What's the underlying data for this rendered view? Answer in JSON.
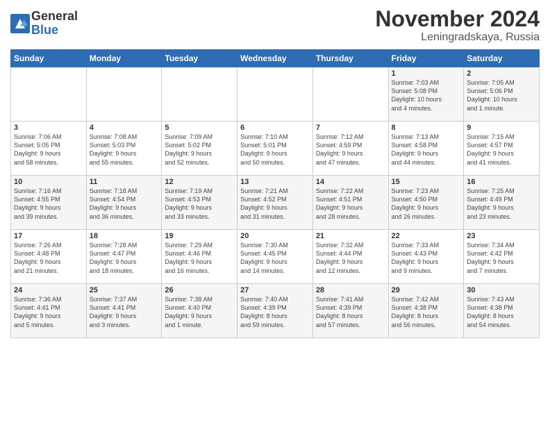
{
  "header": {
    "logo_general": "General",
    "logo_blue": "Blue",
    "month_title": "November 2024",
    "location": "Leningradskaya, Russia"
  },
  "weekdays": [
    "Sunday",
    "Monday",
    "Tuesday",
    "Wednesday",
    "Thursday",
    "Friday",
    "Saturday"
  ],
  "weeks": [
    [
      {
        "day": "",
        "info": ""
      },
      {
        "day": "",
        "info": ""
      },
      {
        "day": "",
        "info": ""
      },
      {
        "day": "",
        "info": ""
      },
      {
        "day": "",
        "info": ""
      },
      {
        "day": "1",
        "info": "Sunrise: 7:03 AM\nSunset: 5:08 PM\nDaylight: 10 hours\nand 4 minutes."
      },
      {
        "day": "2",
        "info": "Sunrise: 7:05 AM\nSunset: 5:06 PM\nDaylight: 10 hours\nand 1 minute."
      }
    ],
    [
      {
        "day": "3",
        "info": "Sunrise: 7:06 AM\nSunset: 5:05 PM\nDaylight: 9 hours\nand 58 minutes."
      },
      {
        "day": "4",
        "info": "Sunrise: 7:08 AM\nSunset: 5:03 PM\nDaylight: 9 hours\nand 55 minutes."
      },
      {
        "day": "5",
        "info": "Sunrise: 7:09 AM\nSunset: 5:02 PM\nDaylight: 9 hours\nand 52 minutes."
      },
      {
        "day": "6",
        "info": "Sunrise: 7:10 AM\nSunset: 5:01 PM\nDaylight: 9 hours\nand 50 minutes."
      },
      {
        "day": "7",
        "info": "Sunrise: 7:12 AM\nSunset: 4:59 PM\nDaylight: 9 hours\nand 47 minutes."
      },
      {
        "day": "8",
        "info": "Sunrise: 7:13 AM\nSunset: 4:58 PM\nDaylight: 9 hours\nand 44 minutes."
      },
      {
        "day": "9",
        "info": "Sunrise: 7:15 AM\nSunset: 4:57 PM\nDaylight: 9 hours\nand 41 minutes."
      }
    ],
    [
      {
        "day": "10",
        "info": "Sunrise: 7:16 AM\nSunset: 4:55 PM\nDaylight: 9 hours\nand 39 minutes."
      },
      {
        "day": "11",
        "info": "Sunrise: 7:18 AM\nSunset: 4:54 PM\nDaylight: 9 hours\nand 36 minutes."
      },
      {
        "day": "12",
        "info": "Sunrise: 7:19 AM\nSunset: 4:53 PM\nDaylight: 9 hours\nand 33 minutes."
      },
      {
        "day": "13",
        "info": "Sunrise: 7:21 AM\nSunset: 4:52 PM\nDaylight: 9 hours\nand 31 minutes."
      },
      {
        "day": "14",
        "info": "Sunrise: 7:22 AM\nSunset: 4:51 PM\nDaylight: 9 hours\nand 28 minutes."
      },
      {
        "day": "15",
        "info": "Sunrise: 7:23 AM\nSunset: 4:50 PM\nDaylight: 9 hours\nand 26 minutes."
      },
      {
        "day": "16",
        "info": "Sunrise: 7:25 AM\nSunset: 4:49 PM\nDaylight: 9 hours\nand 23 minutes."
      }
    ],
    [
      {
        "day": "17",
        "info": "Sunrise: 7:26 AM\nSunset: 4:48 PM\nDaylight: 9 hours\nand 21 minutes."
      },
      {
        "day": "18",
        "info": "Sunrise: 7:28 AM\nSunset: 4:47 PM\nDaylight: 9 hours\nand 18 minutes."
      },
      {
        "day": "19",
        "info": "Sunrise: 7:29 AM\nSunset: 4:46 PM\nDaylight: 9 hours\nand 16 minutes."
      },
      {
        "day": "20",
        "info": "Sunrise: 7:30 AM\nSunset: 4:45 PM\nDaylight: 9 hours\nand 14 minutes."
      },
      {
        "day": "21",
        "info": "Sunrise: 7:32 AM\nSunset: 4:44 PM\nDaylight: 9 hours\nand 12 minutes."
      },
      {
        "day": "22",
        "info": "Sunrise: 7:33 AM\nSunset: 4:43 PM\nDaylight: 9 hours\nand 9 minutes."
      },
      {
        "day": "23",
        "info": "Sunrise: 7:34 AM\nSunset: 4:42 PM\nDaylight: 9 hours\nand 7 minutes."
      }
    ],
    [
      {
        "day": "24",
        "info": "Sunrise: 7:36 AM\nSunset: 4:41 PM\nDaylight: 9 hours\nand 5 minutes."
      },
      {
        "day": "25",
        "info": "Sunrise: 7:37 AM\nSunset: 4:41 PM\nDaylight: 9 hours\nand 3 minutes."
      },
      {
        "day": "26",
        "info": "Sunrise: 7:38 AM\nSunset: 4:40 PM\nDaylight: 9 hours\nand 1 minute."
      },
      {
        "day": "27",
        "info": "Sunrise: 7:40 AM\nSunset: 4:39 PM\nDaylight: 8 hours\nand 59 minutes."
      },
      {
        "day": "28",
        "info": "Sunrise: 7:41 AM\nSunset: 4:39 PM\nDaylight: 8 hours\nand 57 minutes."
      },
      {
        "day": "29",
        "info": "Sunrise: 7:42 AM\nSunset: 4:38 PM\nDaylight: 8 hours\nand 56 minutes."
      },
      {
        "day": "30",
        "info": "Sunrise: 7:43 AM\nSunset: 4:38 PM\nDaylight: 8 hours\nand 54 minutes."
      }
    ]
  ]
}
